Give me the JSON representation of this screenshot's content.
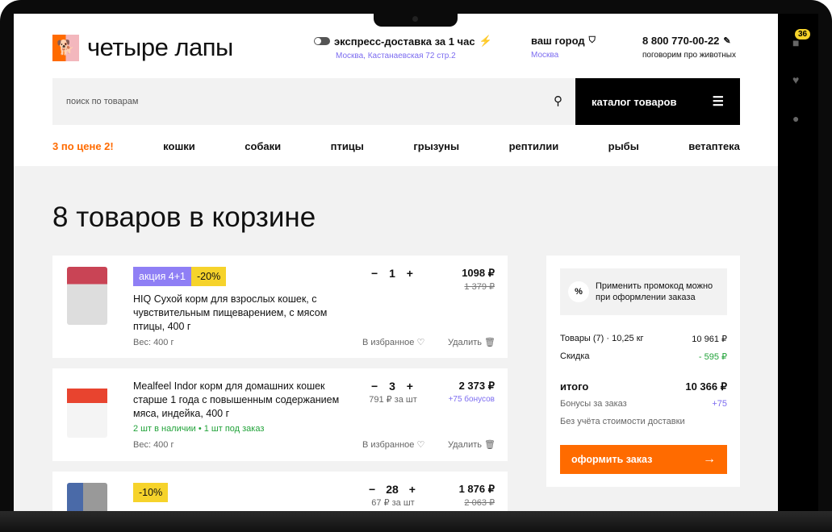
{
  "header": {
    "logo": "четыре лапы",
    "delivery_title": "экспресс-доставка за 1 час",
    "delivery_address": "Москва, Кастанаевская 72 стр.2",
    "city_title": "ваш город",
    "city": "Москва",
    "phone": "8 800 770-00-22",
    "phone_sub": "поговорим про животных",
    "search_placeholder": "поиск по товарам",
    "catalog": "каталог товаров"
  },
  "nav": [
    "3 по цене 2!",
    "кошки",
    "собаки",
    "птицы",
    "грызуны",
    "рептилии",
    "рыбы",
    "ветаптека"
  ],
  "side": {
    "cart_count": "36"
  },
  "page_title": "8 товаров в корзине",
  "items": [
    {
      "tags": [
        "акция 4+1",
        "-20%"
      ],
      "title": "HIQ Сухой корм для взрослых кошек, с чувствительным пищеварением, с мясом птицы, 400 г",
      "weight": "Вес: 400 г",
      "qty": "1",
      "price": "1098 ₽",
      "old_price": "1 379 ₽",
      "favorite": "В избранное",
      "delete": "Удалить"
    },
    {
      "title": "Mealfeel Indor корм для домашних кошек старше 1 года с повышенным содержанием мяса, индейка, 400 г",
      "stock": "2 шт в наличии • 1 шт под заказ",
      "weight": "Вес: 400 г",
      "qty": "3",
      "unit_price": "791 ₽ за шт",
      "price": "2 373 ₽",
      "bonus": "+75 бонусов",
      "favorite": "В избранное",
      "delete": "Удалить"
    },
    {
      "tags": [
        "-10%"
      ],
      "qty": "28",
      "unit_price": "67 ₽ за шт",
      "price": "1 876 ₽",
      "old_price": "2 063 ₽"
    }
  ],
  "summary": {
    "promo": "Применить промокод можно при оформлении заказа",
    "goods_label": "Товары (7) · 10,25 кг",
    "goods_value": "10 961 ₽",
    "discount_label": "Скидка",
    "discount_value": "- 595 ₽",
    "total_label": "итого",
    "total_value": "10 366 ₽",
    "bonus_label": "Бонусы за заказ",
    "bonus_value": "+75",
    "note": "Без учёта стоимости доставки",
    "checkout": "оформить заказ"
  },
  "colors": {
    "accent": "#ff6b00",
    "purple": "#7c6cf0",
    "yellow": "#f6d32b",
    "green": "#22a33a"
  }
}
